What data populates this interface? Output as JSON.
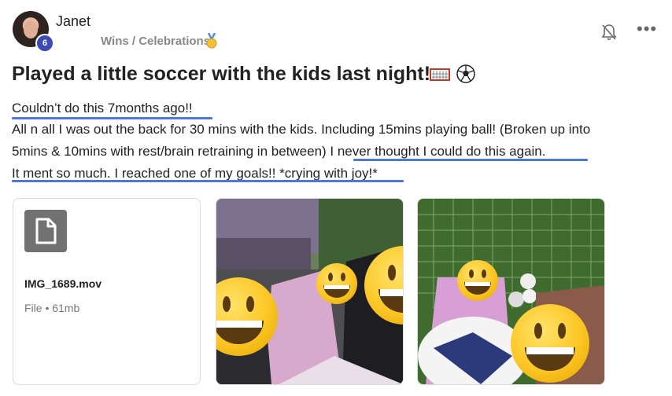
{
  "post": {
    "author": "Janet",
    "badge_count": "6",
    "category": "Wins / Celebrations",
    "title": "Played a little soccer with the kids last night!",
    "body_lines": [
      "Couldn’t do this 7months ago!!",
      "All n all I was out the back for 30 mins with the kids. Including 15mins playing ball! (Broken up into",
      "5mins & 10mins with rest/brain retraining in between) I never thought I could do this again.",
      "It ment so much. I reached one of my goals!! *crying with joy!*"
    ]
  },
  "attachments": {
    "file": {
      "name": "IMG_1689.mov",
      "meta": "File • 61mb"
    }
  },
  "colors": {
    "underline": "#4a78dd",
    "badge": "#3e4bb5"
  },
  "icons": [
    "bell-icon",
    "more-icon",
    "file-icon",
    "medal-icon",
    "soccer-ball-icon",
    "goal-net-icon"
  ]
}
